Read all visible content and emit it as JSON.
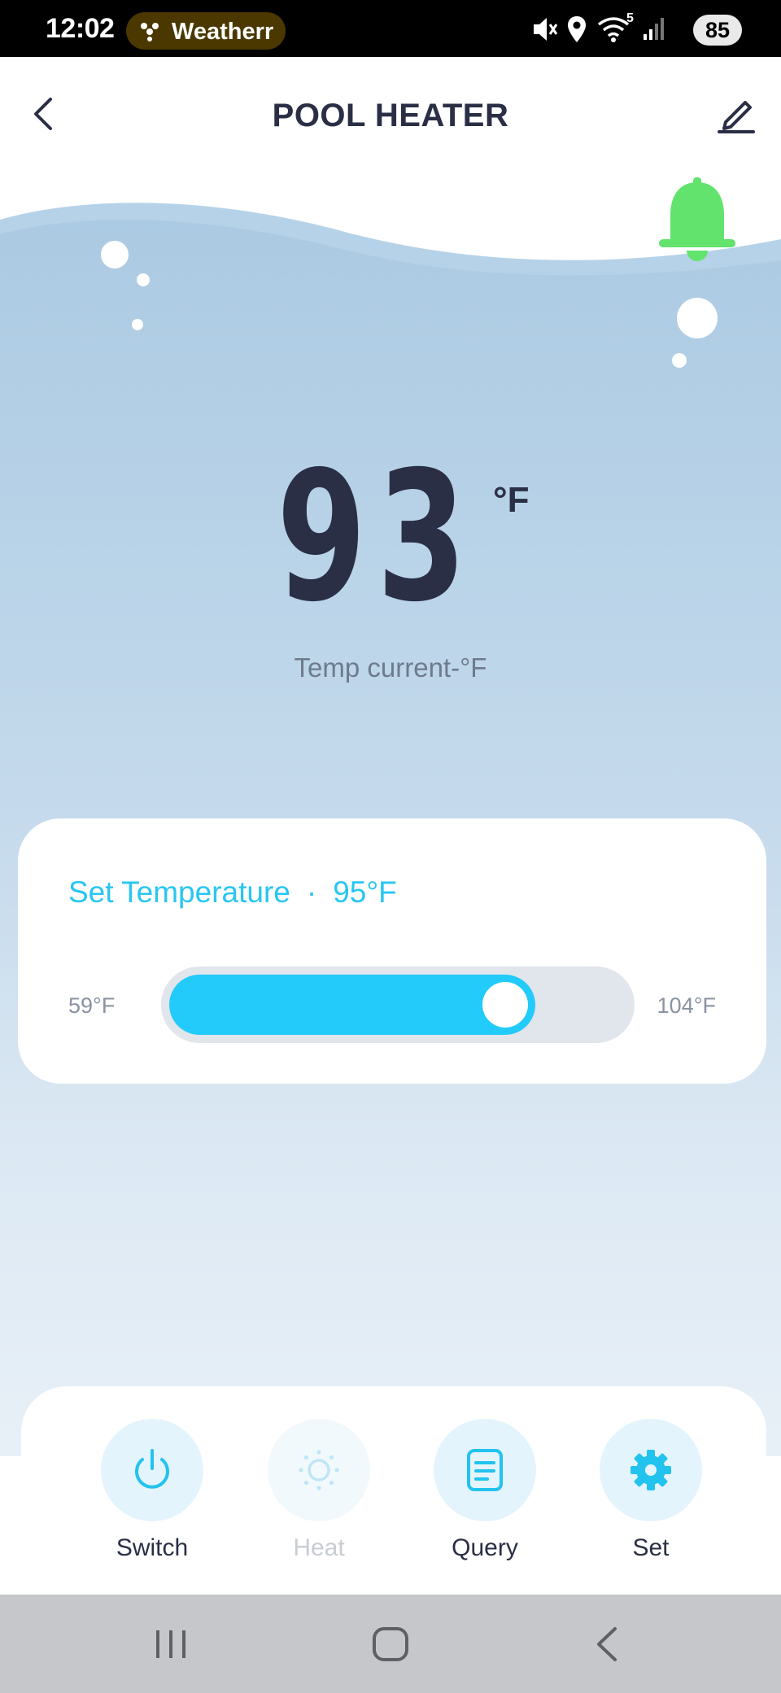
{
  "status_bar": {
    "time": "12:02",
    "notification_pill_text": "Weatherr",
    "notification_pill_icon": "weather-app-icon",
    "icons": [
      "mute-icon",
      "location-icon",
      "wifi-icon",
      "signal-icon"
    ],
    "wifi_badge": "5",
    "battery": "85"
  },
  "header": {
    "title": "POOL HEATER",
    "back_icon": "chevron-left-icon",
    "edit_icon": "pencil-icon"
  },
  "alarm": {
    "icon": "bell-icon",
    "color": "#62e36e"
  },
  "current_temperature": {
    "value": "93",
    "unit": "°F",
    "label": "Temp current-°F"
  },
  "set_temperature": {
    "title": "Set Temperature",
    "separator": "·",
    "value_text": "95°F",
    "min_label": "59°F",
    "max_label": "104°F",
    "min": 59,
    "max": 104,
    "value": 95,
    "accent_color": "#22cbfa"
  },
  "actions": [
    {
      "label": "Switch",
      "icon": "power-icon",
      "enabled": true
    },
    {
      "label": "Heat",
      "icon": "sun-icon",
      "enabled": false
    },
    {
      "label": "Query",
      "icon": "document-icon",
      "enabled": true
    },
    {
      "label": "Set",
      "icon": "gear-icon",
      "enabled": true
    }
  ],
  "nav_bar": {
    "buttons": [
      "recent-apps-icon",
      "home-icon",
      "back-icon"
    ]
  }
}
